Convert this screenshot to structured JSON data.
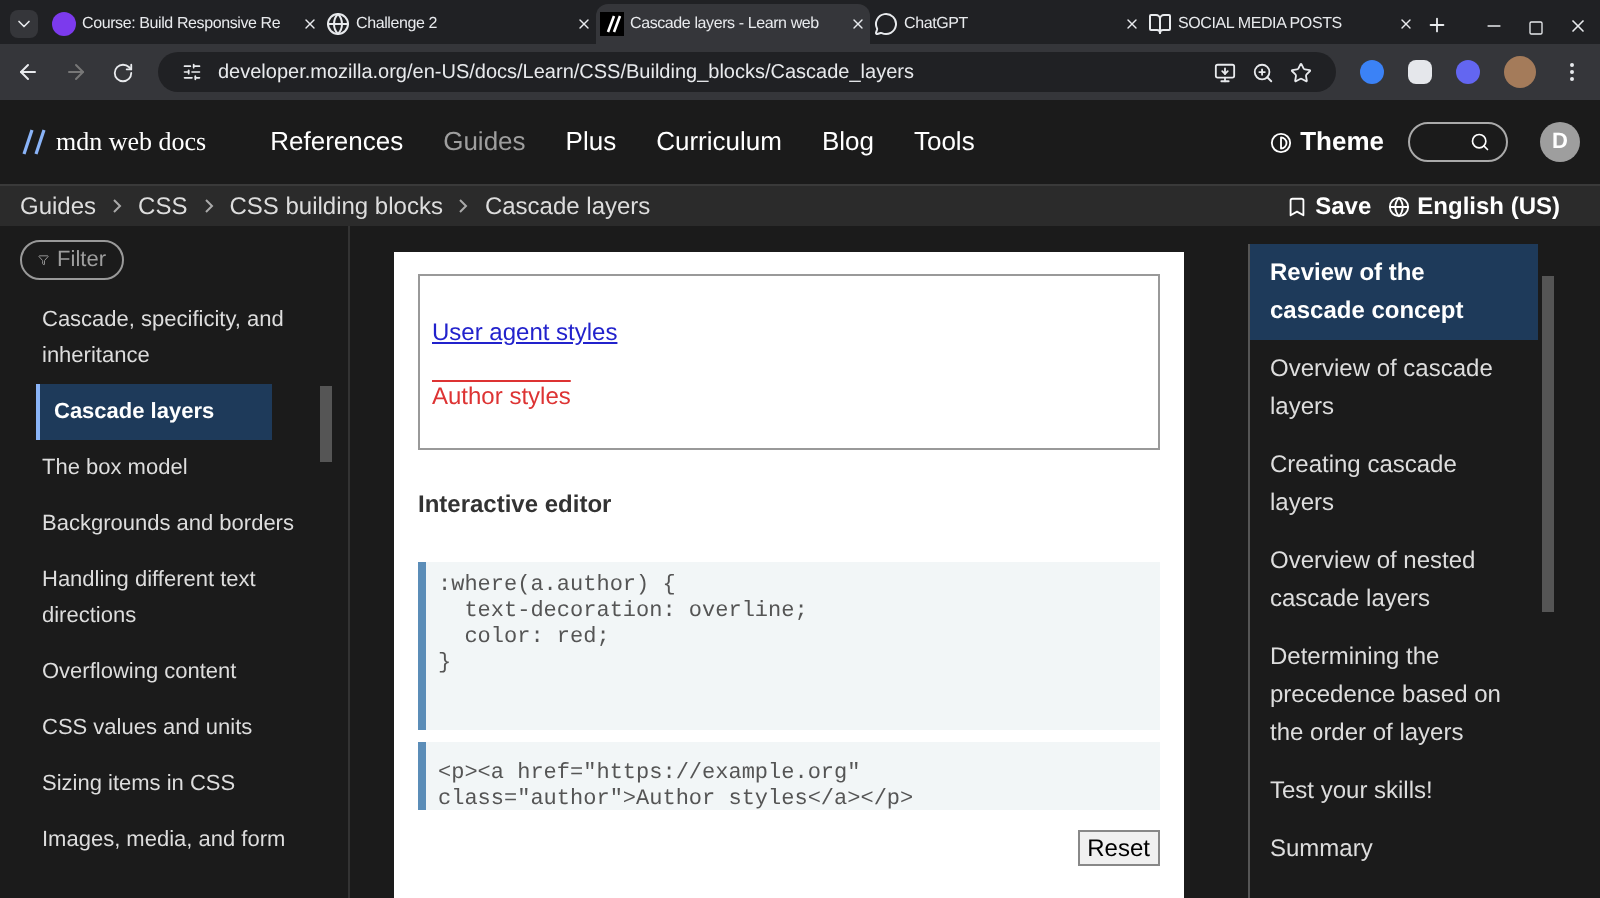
{
  "browser": {
    "tabs": [
      {
        "title": "Course: Build Responsive Re",
        "selected": false
      },
      {
        "title": "Challenge 2",
        "selected": false
      },
      {
        "title": "Cascade layers - Learn web",
        "selected": true
      },
      {
        "title": "ChatGPT",
        "selected": false
      },
      {
        "title": "SOCIAL MEDIA POSTS",
        "selected": false
      }
    ],
    "url": "developer.mozilla.org/en-US/docs/Learn/CSS/Building_blocks/Cascade_layers"
  },
  "header": {
    "logo": "mdn web docs",
    "nav": [
      {
        "label": "References",
        "selected": false
      },
      {
        "label": "Guides",
        "selected": true
      },
      {
        "label": "Plus",
        "selected": false
      },
      {
        "label": "Curriculum",
        "selected": false
      },
      {
        "label": "Blog",
        "selected": false
      },
      {
        "label": "Tools",
        "selected": false
      }
    ],
    "theme": "Theme",
    "avatar": "D"
  },
  "breadcrumbs": [
    "Guides",
    "CSS",
    "CSS building blocks",
    "Cascade layers"
  ],
  "actions": {
    "save": "Save",
    "language": "English (US)"
  },
  "sidebar": {
    "filter": {
      "placeholder": "Filter"
    },
    "items": [
      {
        "label": "Cascade, specificity, and inheritance",
        "selected": false
      },
      {
        "label": "Cascade layers",
        "selected": true
      },
      {
        "label": "The box model",
        "selected": false
      },
      {
        "label": "Backgrounds and borders",
        "selected": false
      },
      {
        "label": "Handling different text directions",
        "selected": false
      },
      {
        "label": "Overflowing content",
        "selected": false
      },
      {
        "label": "CSS values and units",
        "selected": false
      },
      {
        "label": "Sizing items in CSS",
        "selected": false
      },
      {
        "label": "Images, media, and form",
        "selected": false
      }
    ]
  },
  "example": {
    "output": [
      {
        "text": "User agent styles",
        "kind": "ua"
      },
      {
        "text": "Author styles",
        "kind": "author"
      }
    ],
    "heading": "Interactive editor",
    "css_code": [
      ":where(a.author) {",
      "  text-decoration: overline;",
      "  color: red;",
      "}"
    ],
    "html_code": [
      "<p><a href=\"https://example.org\"",
      "class=\"author\">Author styles</a></p>"
    ],
    "reset": "Reset"
  },
  "toc": [
    {
      "label": "Review of the cascade concept",
      "selected": true
    },
    {
      "label": "Overview of cascade layers",
      "selected": false
    },
    {
      "label": "Creating cascade layers",
      "selected": false
    },
    {
      "label": "Overview of nested cascade layers",
      "selected": false
    },
    {
      "label": "Determining the precedence based on the order of layers",
      "selected": false
    },
    {
      "label": "Test your skills!",
      "selected": false
    },
    {
      "label": "Summary",
      "selected": false
    }
  ]
}
